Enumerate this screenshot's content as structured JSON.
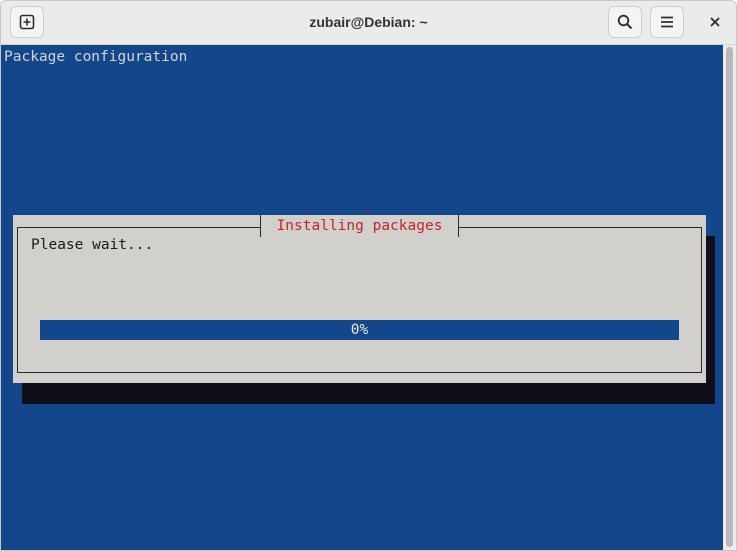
{
  "window": {
    "title": "zubair@Debian: ~"
  },
  "titlebar": {
    "new_tab_icon": "new-tab-icon",
    "search_icon": "search-icon",
    "menu_icon": "hamburger-menu-icon",
    "close_icon": "close-icon"
  },
  "terminal": {
    "header": "Package configuration",
    "background_color": "#13468a",
    "dialog": {
      "title": "Installing packages",
      "message": "Please wait...",
      "progress_percent": 0,
      "progress_label": "0%",
      "title_color": "#c8232a",
      "background_color": "#d1d0cd"
    }
  }
}
